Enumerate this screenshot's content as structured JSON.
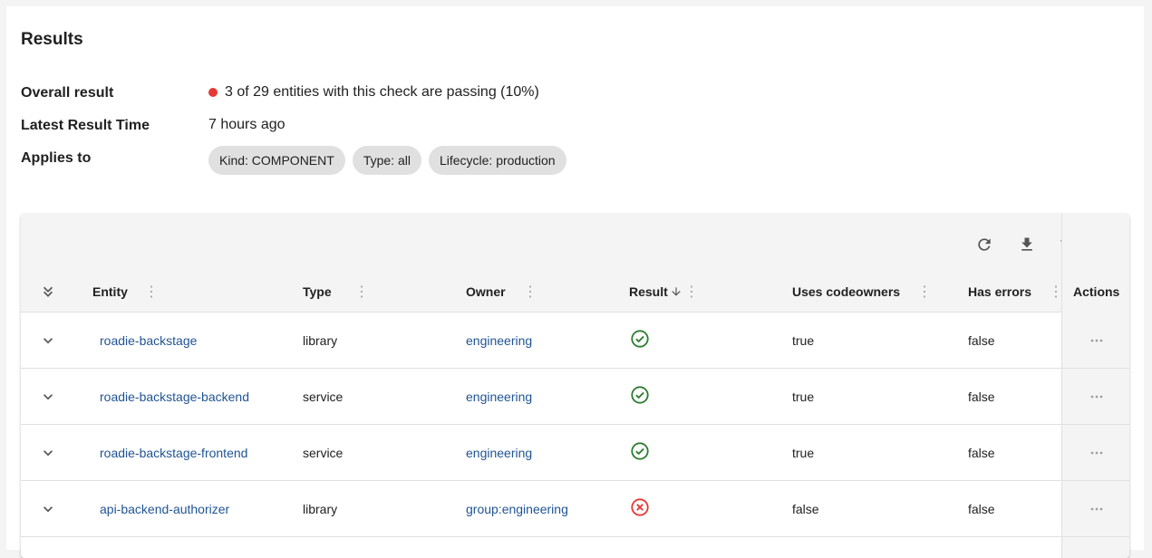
{
  "results": {
    "title": "Results",
    "overall_label": "Overall result",
    "overall_value": "3 of 29 entities with this check are passing (10%)",
    "overall_status_color": "#e53935",
    "latest_label": "Latest Result Time",
    "latest_value": "7 hours ago",
    "applies_label": "Applies to",
    "chips": [
      "Kind: COMPONENT",
      "Type: all",
      "Lifecycle: production"
    ]
  },
  "toolbar": {
    "icons": [
      "refresh-icon",
      "download-icon",
      "filter-icon",
      "columns-icon"
    ]
  },
  "table": {
    "columns": [
      "Entity",
      "Type",
      "Owner",
      "Result",
      "Uses codeowners",
      "Has errors",
      "Actions"
    ],
    "sorted_column": "Result",
    "sort_direction": "descending",
    "rows": [
      {
        "entity": "roadie-backstage",
        "type": "library",
        "owner": "engineering",
        "result": "pass",
        "uses_codeowners": "true",
        "has_errors": "false"
      },
      {
        "entity": "roadie-backstage-backend",
        "type": "service",
        "owner": "engineering",
        "result": "pass",
        "uses_codeowners": "true",
        "has_errors": "false"
      },
      {
        "entity": "roadie-backstage-frontend",
        "type": "service",
        "owner": "engineering",
        "result": "pass",
        "uses_codeowners": "true",
        "has_errors": "false"
      },
      {
        "entity": "api-backend-authorizer",
        "type": "library",
        "owner": "group:engineering",
        "result": "fail",
        "uses_codeowners": "false",
        "has_errors": "false"
      }
    ],
    "colors": {
      "pass": "#2e7d32",
      "fail": "#e53935",
      "link": "#1f5493"
    }
  }
}
